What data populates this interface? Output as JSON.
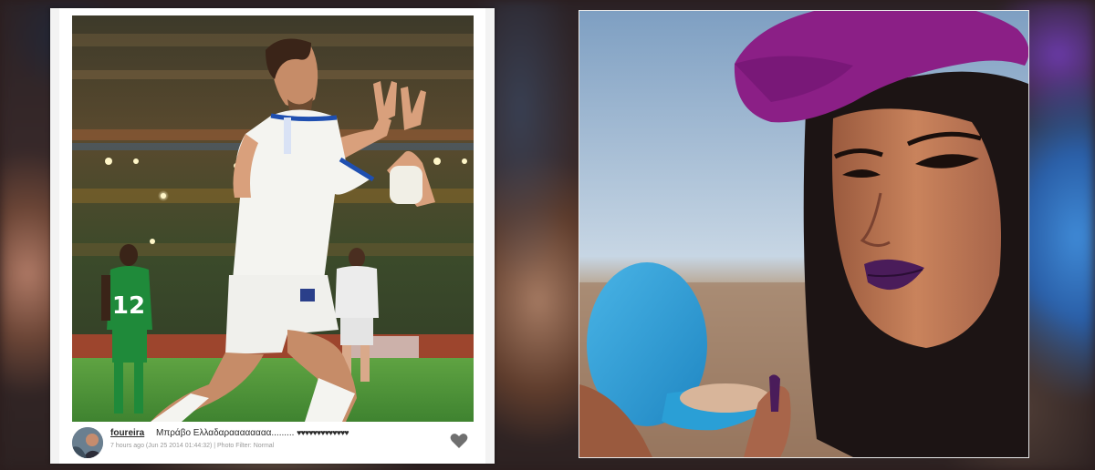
{
  "post": {
    "username": "foureira",
    "caption": "Μπράβο Ελλαδαραααααααα.........",
    "hearts": "♥♥♥♥♥♥♥♥♥♥♥♥♥",
    "timestamp": "7 hours ago (Jun 25 2014 01:44:32) | Photo Filter: Normal",
    "player_number": "12",
    "like_icon": "heart-icon"
  },
  "colors": {
    "hat": "#8b1f86",
    "lipstick": "#4a1c5a",
    "compact": "#2a9fd6",
    "jersey_white": "#f4f4f0",
    "jersey_green": "#1f8a3a",
    "pitch": "#4f9a3a"
  }
}
